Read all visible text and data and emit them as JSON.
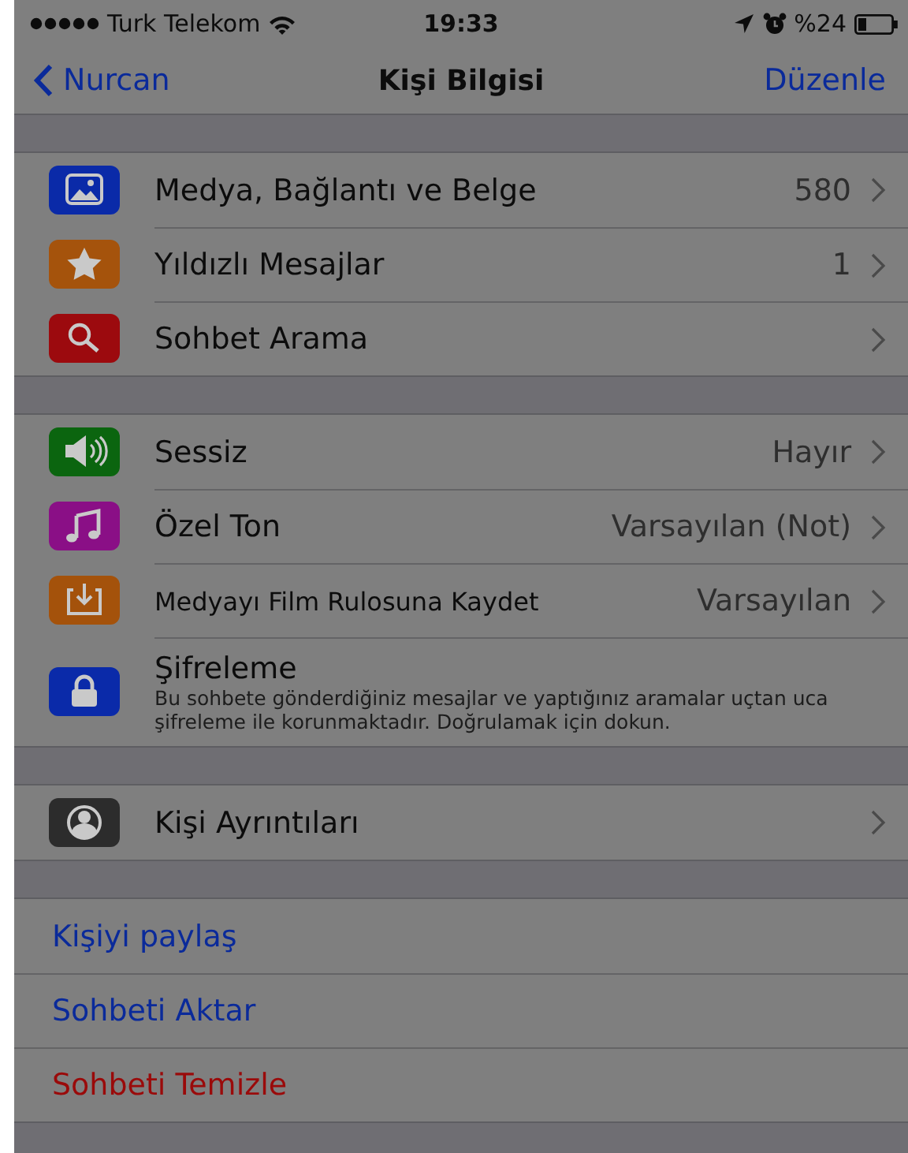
{
  "status_bar": {
    "carrier": "Turk Telekom",
    "time": "19:33",
    "battery": "%24"
  },
  "navigation_bar": {
    "back": "Nurcan",
    "title": "Kişi Bilgisi",
    "action": "Düzenle"
  },
  "sections": [
    {
      "rows": [
        {
          "kind": "item",
          "color": "#0a2aa8",
          "label": "Medya, Bağlantı ve Belge",
          "value": "580"
        },
        {
          "kind": "item",
          "color": "#a5530c",
          "label": "Yıldızlı Mesajlar",
          "value": "1"
        },
        {
          "kind": "item",
          "color": "#9c0a0e",
          "label": "Sohbet Arama"
        }
      ]
    },
    {
      "rows": [
        {
          "kind": "item",
          "color": "#0b650f",
          "label": "Sessiz",
          "value": "Hayır"
        },
        {
          "kind": "item",
          "color": "#8a0f86",
          "label": "Özel Ton",
          "value": "Varsayılan (Not)"
        },
        {
          "kind": "item",
          "color": "#a4520b",
          "label": "Medyayı Film Rulosuna Kaydet",
          "value": "Varsayılan"
        },
        {
          "kind": "detail",
          "color": "#0a2aa9",
          "label": "Şifreleme",
          "description": "Bu sohbete gönderdiğiniz mesajlar ve yaptığınız aramalar uçtan uca şifreleme ile korunmaktadır. Doğrulamak için dokun."
        }
      ]
    },
    {
      "rows": [
        {
          "kind": "item",
          "color": "#2c2c2c",
          "label": "Kişi Ayrıntıları"
        }
      ]
    },
    {
      "rows": [
        {
          "kind": "action",
          "destructive": false,
          "label": "Kişiyi paylaş"
        },
        {
          "kind": "action",
          "destructive": false,
          "label": "Sohbeti Aktar"
        },
        {
          "kind": "action",
          "destructive": true,
          "label": "Sohbeti Temizle"
        }
      ]
    }
  ]
}
